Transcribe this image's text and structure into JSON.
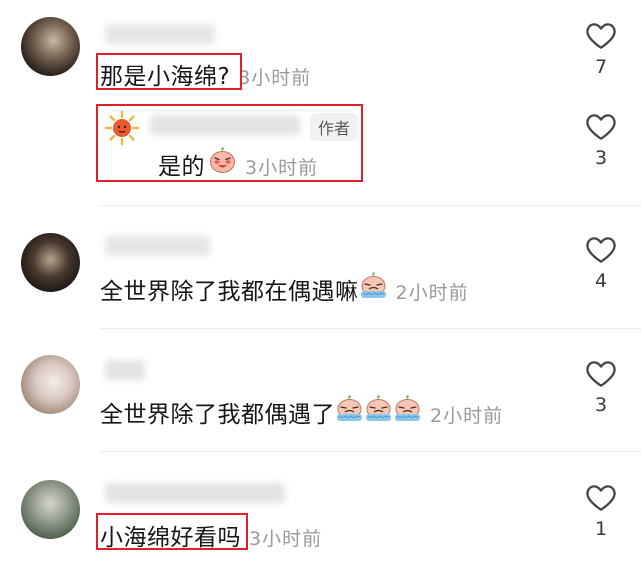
{
  "comments": [
    {
      "text": "那是小海绵?",
      "time": "3小时前",
      "likes": "7"
    },
    {
      "text": "是的",
      "time": "3小时前",
      "likes": "3",
      "badge": "作者",
      "is_reply": true
    },
    {
      "text": "全世界除了我都在偶遇嘛",
      "time": "2小时前",
      "likes": "4"
    },
    {
      "text": "全世界除了我都偶遇了",
      "time": "2小时前",
      "likes": "3"
    },
    {
      "text": "小海绵好看吗",
      "time": "3小时前",
      "likes": "1"
    }
  ],
  "icons": {
    "like": "heart-outline-icon",
    "emoji_blush": "blushing-face-emoji",
    "emoji_cry": "crying-baby-emoji",
    "author_avatar": "sun-icon"
  },
  "colors": {
    "highlight": "#e2202b",
    "time": "#9a9a9a",
    "divider": "#ececec"
  }
}
